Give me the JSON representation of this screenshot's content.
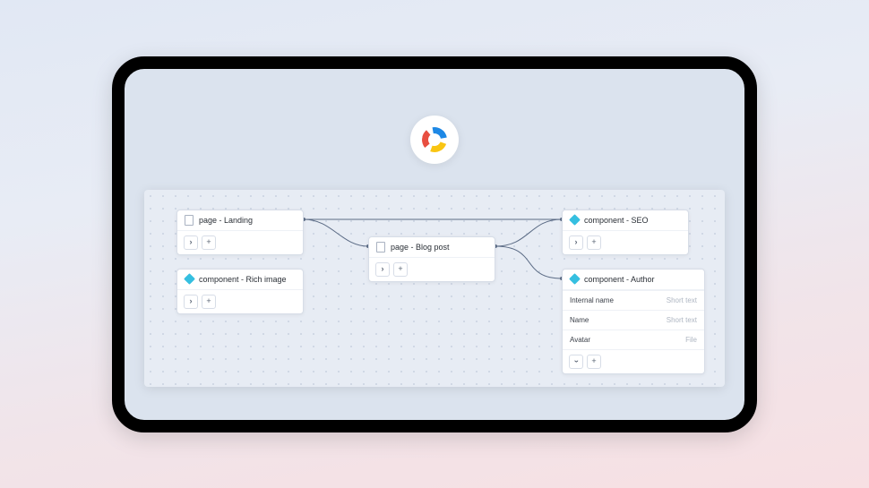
{
  "logo": {
    "name": "contentful"
  },
  "nodes": {
    "landing": {
      "label": "page - Landing",
      "icon": "page"
    },
    "rich": {
      "label": "component - Rich image",
      "icon": "component"
    },
    "blog": {
      "label": "page - Blog post",
      "icon": "page"
    },
    "seo": {
      "label": "component - SEO",
      "icon": "component"
    },
    "author": {
      "label": "component - Author",
      "icon": "component",
      "fields": [
        {
          "name": "Internal name",
          "type": "Short text"
        },
        {
          "name": "Name",
          "type": "Short text"
        },
        {
          "name": "Avatar",
          "type": "File"
        }
      ]
    }
  }
}
